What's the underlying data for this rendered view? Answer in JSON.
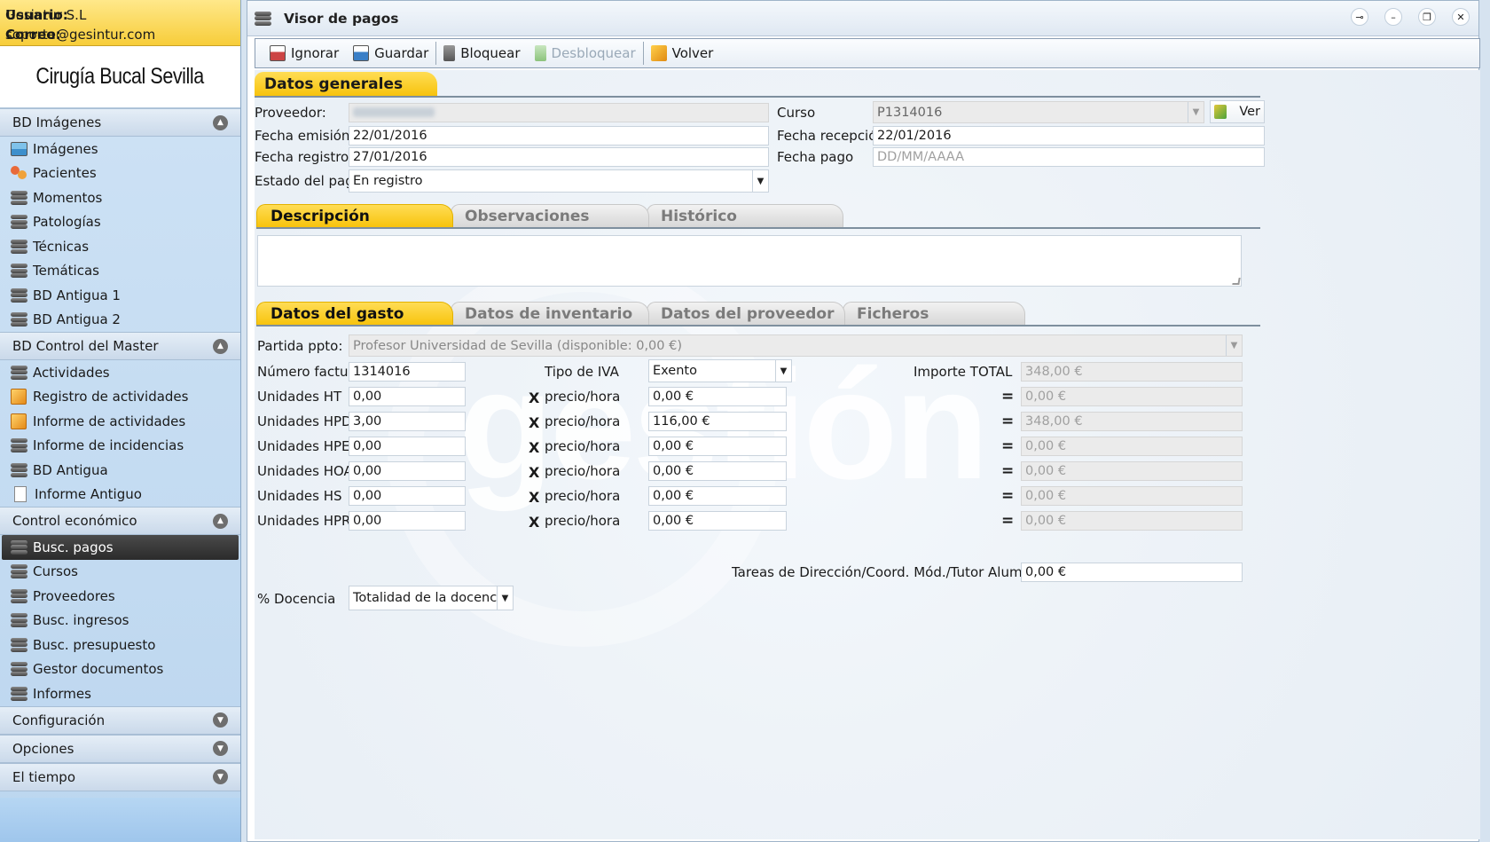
{
  "user": {
    "usuario_label": "Usuario:",
    "usuario_value": "Gesintur S.L",
    "correo_label": "Correo:",
    "correo_value": "soporte@gesintur.com"
  },
  "brand": "Cirugía Bucal Sevilla",
  "sidebar": {
    "sections": [
      {
        "label": "BD Imágenes",
        "expanded": true,
        "items": [
          "Imágenes",
          "Pacientes",
          "Momentos",
          "Patologías",
          "Técnicas",
          "Temáticas",
          "BD Antigua 1",
          "BD Antigua 2"
        ]
      },
      {
        "label": "BD Control del Master",
        "expanded": true,
        "items": [
          "Actividades",
          "Registro de actividades",
          "Informe de actividades",
          "Informe de incidencias",
          "BD Antigua",
          "Informe Antiguo"
        ]
      },
      {
        "label": "Control económico",
        "expanded": true,
        "active_item": "Busc. pagos",
        "items": [
          "Busc. pagos",
          "Cursos",
          "Proveedores",
          "Busc. ingresos",
          "Busc. presupuesto",
          "Gestor documentos",
          "Informes"
        ]
      },
      {
        "label": "Configuración",
        "expanded": false
      },
      {
        "label": "Opciones",
        "expanded": false
      },
      {
        "label": "El tiempo",
        "expanded": false
      }
    ]
  },
  "window": {
    "title": "Visor de pagos",
    "controls": [
      "pin-icon",
      "minimize-icon",
      "restore-icon",
      "close-icon"
    ]
  },
  "toolbar": {
    "ignorar": "Ignorar",
    "guardar": "Guardar",
    "bloquear": "Bloquear",
    "desbloquear": "Desbloquear",
    "volver": "Volver"
  },
  "datos_generales": {
    "header": "Datos generales",
    "proveedor_label": "Proveedor:",
    "proveedor_value": "",
    "curso_label": "Curso",
    "curso_value": "P1314016",
    "ver_button": "Ver",
    "fecha_emision_label": "Fecha emisión",
    "fecha_emision_value": "22/01/2016",
    "fecha_recepcion_label": "Fecha recepción",
    "fecha_recepcion_value": "22/01/2016",
    "fecha_registro_label": "Fecha registro",
    "fecha_registro_value": "27/01/2016",
    "fecha_pago_label": "Fecha pago",
    "fecha_pago_placeholder": "DD/MM/AAAA",
    "estado_label": "Estado del pago",
    "estado_value": "En registro"
  },
  "desc_tabs": {
    "active": "Descripción",
    "tabs": [
      "Descripción",
      "Observaciones",
      "Histórico"
    ],
    "descripcion_text": ""
  },
  "gasto_tabs": {
    "active": "Datos del gasto",
    "tabs": [
      "Datos del gasto",
      "Datos de inventario",
      "Datos del proveedor",
      "Ficheros"
    ]
  },
  "gasto": {
    "partida_label": "Partida ppto:",
    "partida_value": "Profesor Universidad de Sevilla (disponible: 0,00 €)",
    "numero_factura_label": "Número factura",
    "numero_factura_value": "1314016",
    "tipo_iva_label": "Tipo de IVA",
    "tipo_iva_value": "Exento",
    "importe_total_label": "Importe TOTAL",
    "importe_total_value": "348,00 €",
    "x_symbol": "X",
    "eq_symbol": "=",
    "rows": [
      {
        "label": "Unidades HT",
        "units": "0,00",
        "rate_label": "precio/hora",
        "rate": "0,00 €",
        "total": "0,00 €"
      },
      {
        "label": "Unidades HPD",
        "units": "3,00",
        "rate_label": "precio/hora",
        "rate": "116,00 €",
        "total": "348,00 €"
      },
      {
        "label": "Unidades HPE",
        "units": "0,00",
        "rate_label": "precio/hora",
        "rate": "0,00 €",
        "total": "0,00 €"
      },
      {
        "label": "Unidades HOA",
        "units": "0,00",
        "rate_label": "precio/hora",
        "rate": "0,00 €",
        "total": "0,00 €"
      },
      {
        "label": "Unidades HS",
        "units": "0,00",
        "rate_label": "precio/hora",
        "rate": "0,00 €",
        "total": "0,00 €"
      },
      {
        "label": "Unidades HPR",
        "units": "0,00",
        "rate_label": "precio/hora",
        "rate": "0,00 €",
        "total": "0,00 €"
      }
    ],
    "tareas_label": "Tareas de Dirección/Coord. Mód./Tutor Alumnos",
    "tareas_value": "0,00 €",
    "docencia_label": "% Docencia",
    "docencia_value": "Totalidad de la docencia"
  },
  "watermark_text": "gestión"
}
